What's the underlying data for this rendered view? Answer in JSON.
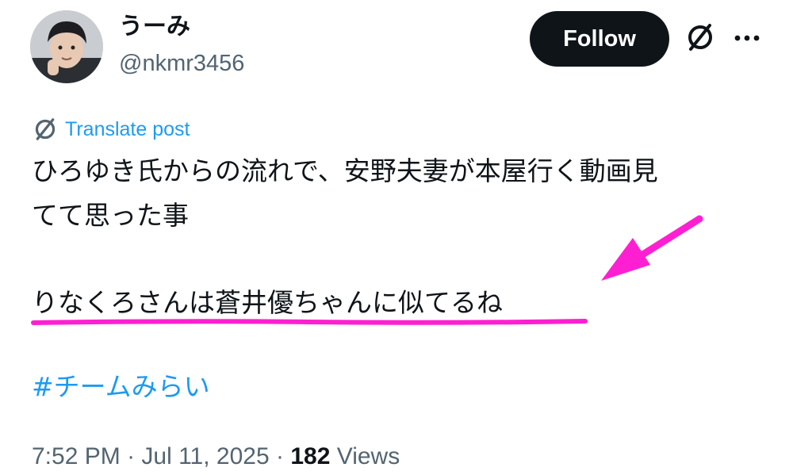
{
  "tweet": {
    "display_name": "うーみ",
    "handle": "@nkmr3456",
    "follow_label": "Follow",
    "translate_label": "Translate post",
    "body_line1": "ひろゆき氏からの流れで、安野夫妻が本屋行く動画見",
    "body_line2": "てて思った事",
    "body_line3": "りなくろさんは蒼井優ちゃんに似てるね",
    "hashtag": "#チームみらい",
    "time": "7:52 PM",
    "sep1": " · ",
    "date": "Jul 11, 2025",
    "sep2": " · ",
    "views_count": "182",
    "views_label": " Views"
  },
  "icons": {
    "grok": "grok-icon",
    "more": "more-icon",
    "translate": "translate-icon"
  },
  "colors": {
    "accent": "#1d9bf0",
    "follow_bg": "#0f1419",
    "muted_text": "#536471",
    "annotation": "#ff1fd2"
  }
}
